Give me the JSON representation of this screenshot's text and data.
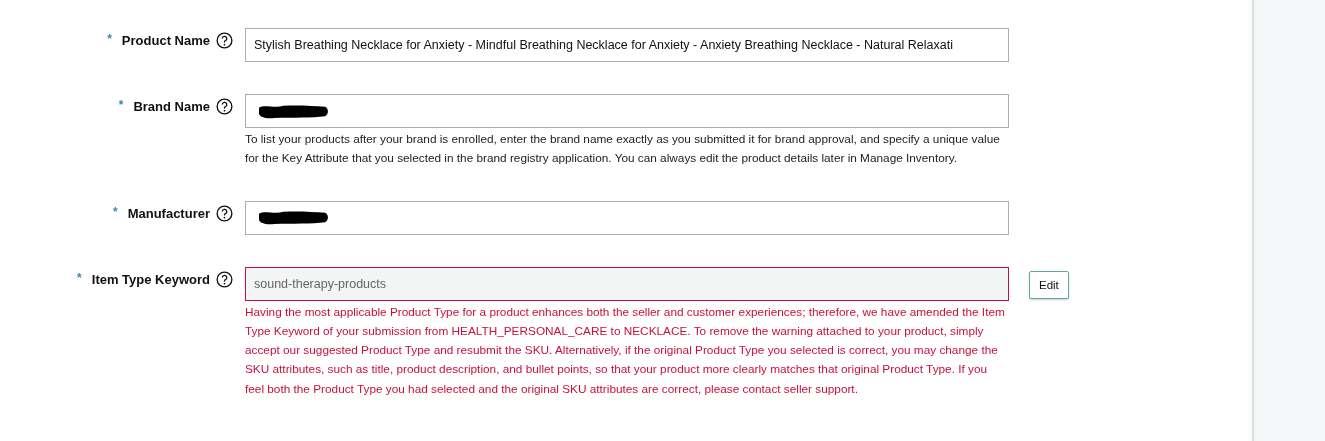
{
  "fields": [
    {
      "required_mark": "*",
      "label": "Product Name",
      "required": true,
      "value": "Stylish Breathing Necklace for Anxiety - Mindful Breathing Necklace for Anxiety - Anxiety Breathing Necklace - Natural Relaxati",
      "redacted": false,
      "error": false,
      "disabled": false
    },
    {
      "required_mark": "*",
      "label": "Brand Name",
      "required": true,
      "redacted": true,
      "error": false,
      "disabled": false,
      "help": "To list your products after your brand is enrolled, enter the brand name exactly as you submitted it for brand approval, and specify a unique value for the Key Attribute that you selected in the brand registry application. You can always edit the product details later in Manage Inventory."
    },
    {
      "required_mark": "*",
      "label": "Manufacturer",
      "required": true,
      "redacted": true,
      "error": false,
      "disabled": false
    },
    {
      "required_mark": "*",
      "label": "Item Type Keyword",
      "required": true,
      "value": "sound-therapy-products",
      "redacted": false,
      "error": true,
      "disabled": true,
      "action": "Edit",
      "help": "Having the most applicable Product Type for a product enhances both the seller and customer experiences; therefore, we have amended the Item Type Keyword of your submission from HEALTH_PERSONAL_CARE to NECKLACE. To remove the warning attached to your product, simply accept our suggested Product Type and resubmit the SKU. Alternatively, if the original Product Type you selected is correct, you may change the SKU attributes, such as title, product description, and bullet points, so that your product more clearly matches that original Product Type. If you feel both the Product Type you had selected and the original SKU attributes are correct, please contact seller support."
    }
  ]
}
